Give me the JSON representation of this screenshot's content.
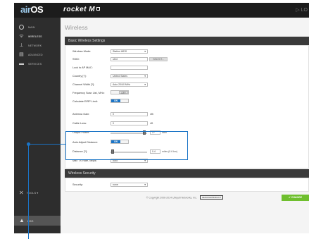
{
  "topbar": {
    "brand_ai": "air",
    "brand_os": "OS",
    "product": "rocket M",
    "right_text": "▷ LO"
  },
  "sidebar": {
    "items": [
      {
        "icon": "main-icon",
        "label": "Main"
      },
      {
        "icon": "wireless-icon",
        "label": "Wireless"
      },
      {
        "icon": "network-icon",
        "label": "Network"
      },
      {
        "icon": "advanced-icon",
        "label": "Advanced"
      },
      {
        "icon": "services-icon",
        "label": "Services"
      }
    ],
    "tools": "TOOLS ▾",
    "logout": "LOG"
  },
  "main": {
    "title": "Wireless",
    "basic_header": "Basic Wireless Settings",
    "fields": {
      "mode_label": "Wireless Mode:",
      "mode_value": "Station WDS",
      "ssid_label": "SSID:",
      "ssid_value": "ubnt",
      "select_btn": "SELECT...",
      "lock_label": "Lock to AP MAC:",
      "country_label": "Country [?]:",
      "country_value": "United States",
      "width_label": "Channel Width [?]:",
      "width_value": "Auto 20/40 MHz",
      "freq_label": "Frequency Scan List, MHz:",
      "freq_value": "OFF",
      "eirp_label": "Calculate EIRP Limit:",
      "eirp_value": "ON",
      "gain_label": "Antenna Gain:",
      "gain_value": "0",
      "gain_unit": "dBi",
      "loss_label": "Cable Loss:",
      "loss_value": "0",
      "loss_unit": "dB",
      "power_label": "Output Power:",
      "power_value": "27",
      "power_unit": "dBm",
      "auto_label": "Auto Adjust Distance:",
      "auto_value": "ON",
      "distance_label": "Distance [?]:",
      "distance_value": "0.4",
      "distance_unit": "miles (0.6 km)",
      "rate_label": "Max TX Rate, Mbps:",
      "rate_value": "Auto"
    },
    "security_header": "Wireless Security",
    "security_label": "Security:",
    "security_value": "none",
    "change_btn": "✔ CHANGE"
  },
  "footer": {
    "copyright": "© Copyright 2006-2014 Ubiquiti Networks, Inc.",
    "badge1": "GENUINE",
    "badge2": "PRODUCT"
  },
  "colors": {
    "accent": "#1a74c6",
    "change": "#6fbf2e",
    "topbar": "#1c1c1c"
  },
  "power_slider_fraction": 0.95,
  "distance_slider_fraction": 0.02
}
